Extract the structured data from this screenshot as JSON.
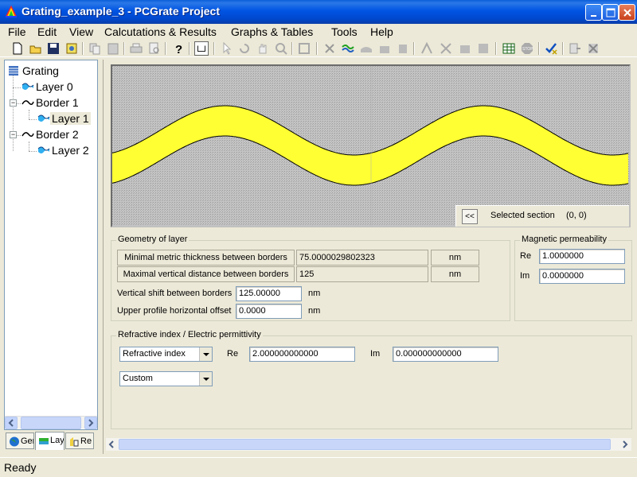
{
  "window": {
    "title": "Grating_example_3 - PCGrate Project",
    "app_icon": "pcgrate-rainbow-icon",
    "buttons": [
      "minimize",
      "maximize",
      "close"
    ]
  },
  "menu": {
    "file": "File",
    "edit": "Edit",
    "view": "View",
    "calculations": "Calcutations & Results",
    "graphs": "Graphs & Tables",
    "tools": "Tools",
    "help": "Help"
  },
  "toolbar": {
    "icons": [
      "new-icon",
      "open-icon",
      "save-icon",
      "properties-icon",
      "copy-icon",
      "paste-icon",
      "print-icon",
      "print-preview-icon",
      "help-icon",
      "layout-icon",
      "pointer-icon",
      "rotate-icon",
      "pan-icon",
      "zoom-icon",
      "fit-icon",
      "delete-icon",
      "add-layer-icon",
      "tool-1-icon",
      "tool-2-icon",
      "tool-3-icon",
      "tool-4-icon",
      "tool-5-icon",
      "tool-6-icon",
      "tool-7-icon",
      "table-icon",
      "stop-icon",
      "check-icon",
      "export-icon",
      "exit-icon"
    ]
  },
  "tree": {
    "items": [
      {
        "label": "Grating",
        "icon": "grating-icon"
      },
      {
        "label": "Layer 0",
        "icon": "layer-icon"
      },
      {
        "label": "Border 1",
        "icon": "border-icon"
      },
      {
        "label": "Layer 1",
        "icon": "layer-icon",
        "selected": true
      },
      {
        "label": "Border 2",
        "icon": "border-icon"
      },
      {
        "label": "Layer 2",
        "icon": "layer-icon"
      }
    ]
  },
  "tabs": [
    {
      "label": "Ger",
      "icon": "globe-icon"
    },
    {
      "label": "Lay",
      "icon": "layers-icon",
      "active": true
    },
    {
      "label": "Re",
      "icon": "results-icon"
    }
  ],
  "canvas": {
    "layer_color": "#ffff33",
    "background_color": "#bdbdbd"
  },
  "section": {
    "collapse_button": "<<",
    "label": "Selected section",
    "value": "(0, 0)"
  },
  "geometry": {
    "title": "Geometry of layer",
    "min_thickness_label": "Minimal metric thickness between borders",
    "min_thickness_value": "75.0000029802323",
    "min_thickness_unit": "nm",
    "max_distance_label": "Maximal vertical distance between borders",
    "max_distance_value": "125",
    "max_distance_unit": "nm",
    "vertical_shift_label": "Vertical shift between borders",
    "vertical_shift_value": "125.00000",
    "vertical_shift_unit": "nm",
    "upper_offset_label": "Upper profile horizontal offset",
    "upper_offset_value": "0.0000",
    "upper_offset_unit": "nm"
  },
  "magnetic": {
    "title": "Magnetic permeability",
    "re_label": "Re",
    "re_value": "1.0000000",
    "im_label": "Im",
    "im_value": "0.0000000"
  },
  "refractive": {
    "title": "Refractive index / Electric permittivity",
    "mode": "Refractive index",
    "re_label": "Re",
    "re_value": "2.000000000000",
    "im_label": "Im",
    "im_value": "0.000000000000",
    "material": "Custom"
  },
  "status": {
    "text": "Ready"
  }
}
